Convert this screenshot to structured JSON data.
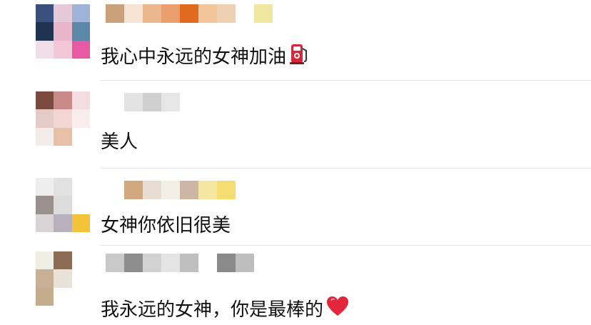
{
  "comments": [
    {
      "text": "我心中永远的女神加油",
      "emoji": "fuel-pump-icon",
      "avatar_colors": [
        "#3a4f7c",
        "#e6c9d6",
        "#9fb3d8",
        "#1f3350",
        "#e8b6c8",
        "#5a86a8",
        "#f0dde6",
        "#f3c6d6",
        "#e75aa3"
      ],
      "name_colors": [
        "#c9a27c",
        "#f4e2d2",
        "#ebb78f",
        "#e9a06c",
        "#e06b1f",
        "#f2c59a",
        "#f0d0b3",
        "#ffffff",
        "#efe6a0"
      ]
    },
    {
      "text": "美人",
      "emoji": "",
      "avatar_colors": [
        "#7b4a3f",
        "#c98a8a",
        "#f3dde0",
        "#e3cbc8",
        "#f1d6d4",
        "#f8eced",
        "#f3ece8",
        "#e7c0a8",
        "#ffffff"
      ],
      "name_colors": [
        "#ffffff",
        "#e3e3e3",
        "#cfcfcf",
        "#e6e6e6",
        "#ffffff",
        "#ffffff",
        "#ffffff",
        "#ffffff",
        "#ffffff"
      ]
    },
    {
      "text": "女神你依旧很美",
      "emoji": "",
      "avatar_colors": [
        "#eeeeee",
        "#e2e2e2",
        "#ffffff",
        "#9b918c",
        "#dcdcdc",
        "#ffffff",
        "#d8d4d6",
        "#b6b1bc",
        "#f3c33a"
      ],
      "name_colors": [
        "#ffffff",
        "#d2a77e",
        "#e6dccf",
        "#f1efe6",
        "#cbb7a4",
        "#f3e7a2",
        "#f4dc70",
        "#ffffff",
        "#ffffff"
      ]
    },
    {
      "text": "我永远的女神，你是最棒的",
      "emoji": "red-heart-icon",
      "avatar_colors": [
        "#efefe6",
        "#8b6b52",
        "#ffffff",
        "#c6b197",
        "#e8e2d8",
        "#ffffff",
        "#c2ae8c",
        "#ffffff",
        "#ffffff"
      ],
      "name_colors": [
        "#c9c9c9",
        "#8e8e8e",
        "#d2d2d2",
        "#e4e4e4",
        "#bfbfbf",
        "#ffffff",
        "#8a8a8a",
        "#bdbdbd",
        "#ffffff"
      ]
    }
  ],
  "colors": {
    "fuel_red": "#d5283b",
    "heart_red": "#e2263b",
    "divider": "#e4e4e4",
    "text": "#111111"
  }
}
